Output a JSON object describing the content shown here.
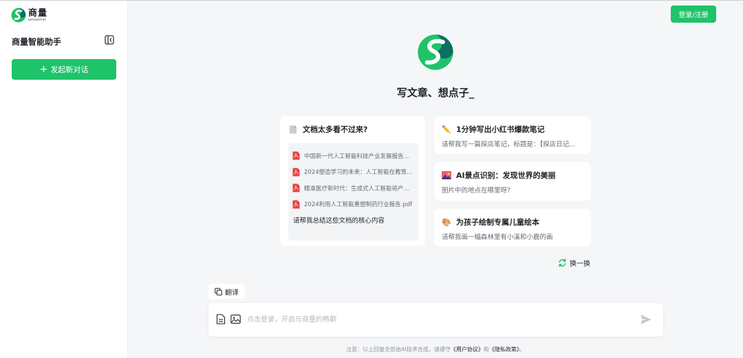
{
  "brand": {
    "name_cn": "商量",
    "name_en": "sensechat"
  },
  "sidebar": {
    "title": "商量智能助手",
    "new_chat_label": "发起新对话"
  },
  "header": {
    "login_label": "登录/注册"
  },
  "hero": {
    "title": "写文章、想点子_"
  },
  "doc_card": {
    "title": "文档太多看不过来?",
    "files": [
      "中国新一代人工智能科技产业发展报告...",
      "2024塑造学习的未来：人工智能在教育4...",
      "精准医疗新时代：生成式人工智能将产...",
      "2024利用人工智能重塑制药行业报告.pdf"
    ],
    "prompt": "请帮我总结这些文档的核心内容"
  },
  "cards": [
    {
      "title": "1分钟写出小红书爆款笔记",
      "subtitle": "请帮我写一篇探店笔记，标题是：【探店日记..."
    },
    {
      "title": "AI景点识别：发现世界的美丽",
      "subtitle": "图片中的地点在哪里呀?"
    },
    {
      "title": "为孩子绘制专属儿童绘本",
      "subtitle": "请帮我画一幅森林里有小溪和小鹿的画"
    }
  ],
  "refresh_label": "换一换",
  "translate_label": "翻译",
  "input": {
    "placeholder": "点击登录，开启与商量的畅聊"
  },
  "footer": {
    "prefix": "注意：以上回复全部由AI技术合成，请遵守",
    "user_agreement": "《用户协议》",
    "and": "和",
    "privacy_policy": "《隐私政策》",
    "suffix": "。"
  },
  "colors": {
    "accent": "#1fc36a",
    "background": "#f5f6f8",
    "pdf_red": "#e8433f"
  },
  "icons": {
    "doc_card": "document-icon",
    "card_1": "pencil-icon",
    "card_2": "landscape-icon",
    "card_3": "palette-icon"
  }
}
